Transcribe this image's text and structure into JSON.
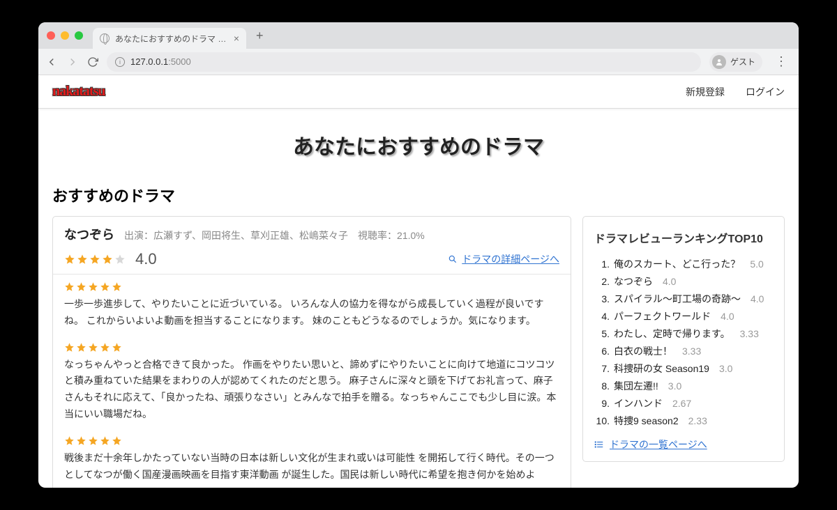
{
  "browser": {
    "tab_title": "あなたにおすすめのドラマ ドラマ",
    "url_host": "127.0.0.1",
    "url_port": ":5000",
    "guest_label": "ゲスト"
  },
  "header": {
    "logo_text": "nakatatsu",
    "links": {
      "register": "新規登録",
      "login": "ログイン"
    }
  },
  "page_title": "あなたにおすすめのドラマ",
  "section_title": "おすすめのドラマ",
  "drama": {
    "title": "なつぞら",
    "cast_label": "出演：広瀬すず、岡田将生、草刈正雄、松嶋菜々子",
    "rating_label": "視聴率：21.0%",
    "score": "4.0",
    "star_full": 4,
    "star_empty": 1,
    "detail_link": "ドラマの詳細ページへ",
    "reviews": [
      {
        "stars": 5,
        "text": "一歩一歩進歩して、やりたいことに近づいている。 いろんな人の協力を得ながら成長していく過程が良いですね。 これからいよいよ動画を担当することになります。 妹のこともどうなるのでしょうか。気になります。"
      },
      {
        "stars": 5,
        "text": "なっちゃんやっと合格できて良かった。 作画をやりたい思いと、諦めずにやりたいことに向けて地道にコツコツと積み重ねていた結果をまわりの人が認めてくれたのだと思う。 麻子さんに深々と頭を下げてお礼言って、麻子さんもそれに応えて、「良かったね、頑張りなさい」とみんなで拍手を贈る。なっちゃんここでも少し目に涙。本当にいい職場だね。"
      },
      {
        "stars": 5,
        "text": "戦後まだ十余年しかたっていない当時の日本は新しい文化が生まれ或いは可能性 を開拓して行く時代。その一つとしてなつが働く国産漫画映画を目指す東洋動画 が誕生した。国民は新しい時代に希望を抱き何かを始めよ"
      }
    ]
  },
  "ranking": {
    "title": "ドラマレビューランキングTOP10",
    "items": [
      {
        "title": "俺のスカート、どこ行った？",
        "score": "5.0"
      },
      {
        "title": "なつぞら",
        "score": "4.0"
      },
      {
        "title": "スパイラル〜町工場の奇跡〜",
        "score": "4.0"
      },
      {
        "title": "パーフェクトワールド",
        "score": "4.0"
      },
      {
        "title": "わたし、定時で帰ります。",
        "score": "3.33"
      },
      {
        "title": "白衣の戦士！",
        "score": "3.33"
      },
      {
        "title": "科捜研の女 Season19",
        "score": "3.0"
      },
      {
        "title": "集団左遷!!",
        "score": "3.0"
      },
      {
        "title": "インハンド",
        "score": "2.67"
      },
      {
        "title": "特捜9 season2",
        "score": "2.33"
      }
    ],
    "all_link": "ドラマの一覧ページへ"
  }
}
